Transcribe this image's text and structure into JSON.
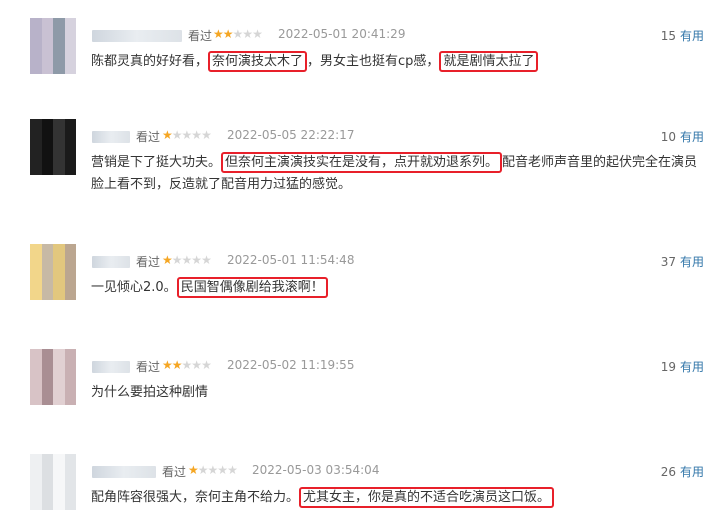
{
  "reviews": [
    {
      "seen": "看过",
      "stars": 2,
      "time": "2022-05-01 20:41:29",
      "votes": "15",
      "help": "有用",
      "text": [
        {
          "t": "陈都灵真的好好看，",
          "hl": false
        },
        {
          "t": "奈何演技太木了",
          "hl": true
        },
        {
          "t": "，男女主也挺有cp感，",
          "hl": false
        },
        {
          "t": "就是剧情太拉了",
          "hl": true
        }
      ]
    },
    {
      "seen": "看过",
      "stars": 1,
      "time": "2022-05-05 22:22:17",
      "votes": "10",
      "help": "有用",
      "text": [
        {
          "t": "营销是下了挺大功夫。",
          "hl": false
        },
        {
          "t": "但奈何主演演技实在是没有，点开就劝退系列。",
          "hl": true
        },
        {
          "t": "配音老师声音里的起伏完全在演员脸上看不到，反造就了配音用力过猛的感觉。",
          "hl": false
        }
      ]
    },
    {
      "seen": "看过",
      "stars": 1,
      "time": "2022-05-01 11:54:48",
      "votes": "37",
      "help": "有用",
      "text": [
        {
          "t": "一见倾心2.0。",
          "hl": false
        },
        {
          "t": "民国智偶像剧给我滚啊！",
          "hl": true
        }
      ]
    },
    {
      "seen": "看过",
      "stars": 2,
      "time": "2022-05-02 11:19:55",
      "votes": "19",
      "help": "有用",
      "text": [
        {
          "t": "为什么要拍这种剧情",
          "hl": false
        }
      ]
    },
    {
      "seen": "看过",
      "stars": 1,
      "time": "2022-05-03 03:54:04",
      "votes": "26",
      "help": "有用",
      "text": [
        {
          "t": "配角阵容很强大，奈何主角不给力。",
          "hl": false
        },
        {
          "t": "尤其女主，你是真的不适合吃演员这口饭。",
          "hl": true
        }
      ]
    }
  ],
  "colors": {
    "highlight_border": "#e8202a",
    "star_on": "#f5a623",
    "star_off": "#d6d6d6",
    "help_link": "#3377aa"
  }
}
